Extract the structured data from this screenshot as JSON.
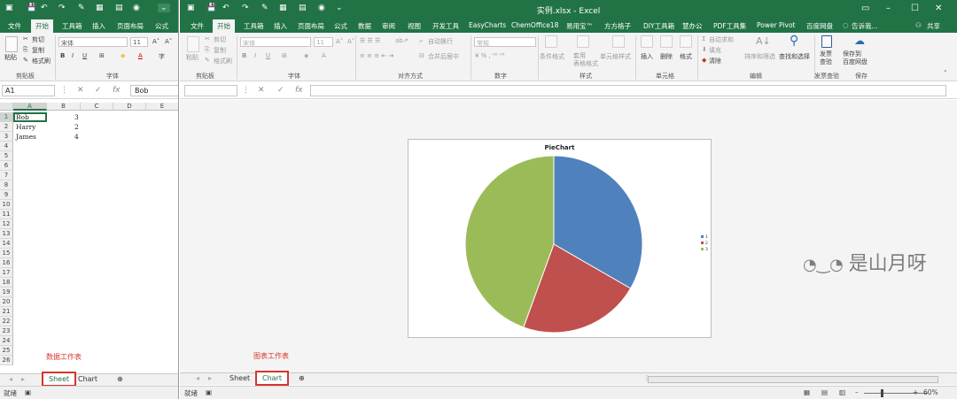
{
  "left_window": {
    "tabs": {
      "file": "文件",
      "home": "开始",
      "toolbox": "工具箱",
      "insert": "插入",
      "layout": "页面布局",
      "formula": "公式"
    },
    "ribbon": {
      "paste": "粘贴",
      "cut": "剪切",
      "copy": "复制",
      "format_painter": "格式刷",
      "font_name": "宋体",
      "font_size": "11",
      "bold": "B",
      "italic": "I",
      "underline": "U",
      "clipboard_group": "剪贴板",
      "font_group": "字体",
      "chinese_size": "字"
    },
    "name_box": "A1",
    "formula_value": "Bob",
    "columns": [
      "A",
      "B",
      "C",
      "D",
      "E"
    ],
    "rows": [
      "1",
      "2",
      "3",
      "4",
      "5",
      "6",
      "7",
      "8",
      "9",
      "10",
      "11",
      "12",
      "13",
      "14",
      "15",
      "16",
      "17",
      "18",
      "19",
      "20",
      "21",
      "22",
      "23",
      "24",
      "25",
      "26"
    ],
    "cells": [
      {
        "row": 1,
        "name": "Bob",
        "value": "3"
      },
      {
        "row": 2,
        "name": "Harry",
        "value": "2"
      },
      {
        "row": 3,
        "name": "James",
        "value": "4"
      }
    ],
    "sheet_tabs": {
      "sheet": "Sheet",
      "chart": "Chart"
    },
    "status": "就绪",
    "annotation": "数据工作表"
  },
  "right_window": {
    "title": "实例.xlsx - Excel",
    "share": "共享",
    "tell_me": "告诉我...",
    "tabs": {
      "file": "文件",
      "home": "开始",
      "toolbox": "工具箱",
      "insert": "插入",
      "layout": "页面布局",
      "formula": "公式",
      "data": "数据",
      "review": "审阅",
      "view": "视图",
      "developer": "开发工具",
      "easycharts": "EasyCharts",
      "chemoffice": "ChemOffice18",
      "easyuse": "易用宝™",
      "fangfang": "方方格子",
      "diy": "DIY工具箱",
      "office": "慧办公",
      "pdf": "PDF工具集",
      "powerpivot": "Power Pivot",
      "baidu": "百度网盘"
    },
    "ribbon": {
      "paste": "粘贴",
      "cut": "剪切",
      "copy": "复制",
      "format_painter": "格式刷",
      "font_name": "宋体",
      "font_size": "11",
      "wrap_text": "自动换行",
      "merge_center": "合并后居中",
      "number_format": "常规",
      "conditional_format": "条件格式",
      "table_format": "套用\n表格格式",
      "cell_style": "单元格样式",
      "insert": "插入",
      "delete": "删除",
      "format": "格式",
      "autosum": "自动求和",
      "fill": "填充",
      "clear": "清除",
      "sort_filter": "排序和筛选",
      "find_select": "查找和选择",
      "invoice_check": "发票\n查验",
      "save_baidu": "保存到\n百度网盘",
      "groups": {
        "clipboard": "剪贴板",
        "font": "字体",
        "alignment": "对齐方式",
        "number": "数字",
        "style": "样式",
        "cells": "单元格",
        "editing": "编辑",
        "invoice": "发票查验",
        "save": "保存"
      }
    },
    "chart_data": {
      "type": "pie",
      "title": "PieChart",
      "categories": [
        "1",
        "2",
        "3"
      ],
      "values": [
        3,
        2,
        4
      ],
      "colors": [
        "#4f81bd",
        "#c0504d",
        "#9bbb59"
      ],
      "legend_position": "right"
    },
    "sheet_tabs": {
      "sheet": "Sheet",
      "chart": "Chart"
    },
    "status": "就绪",
    "zoom": "60%",
    "annotation": "图表工作表",
    "watermark": "是山月呀"
  }
}
